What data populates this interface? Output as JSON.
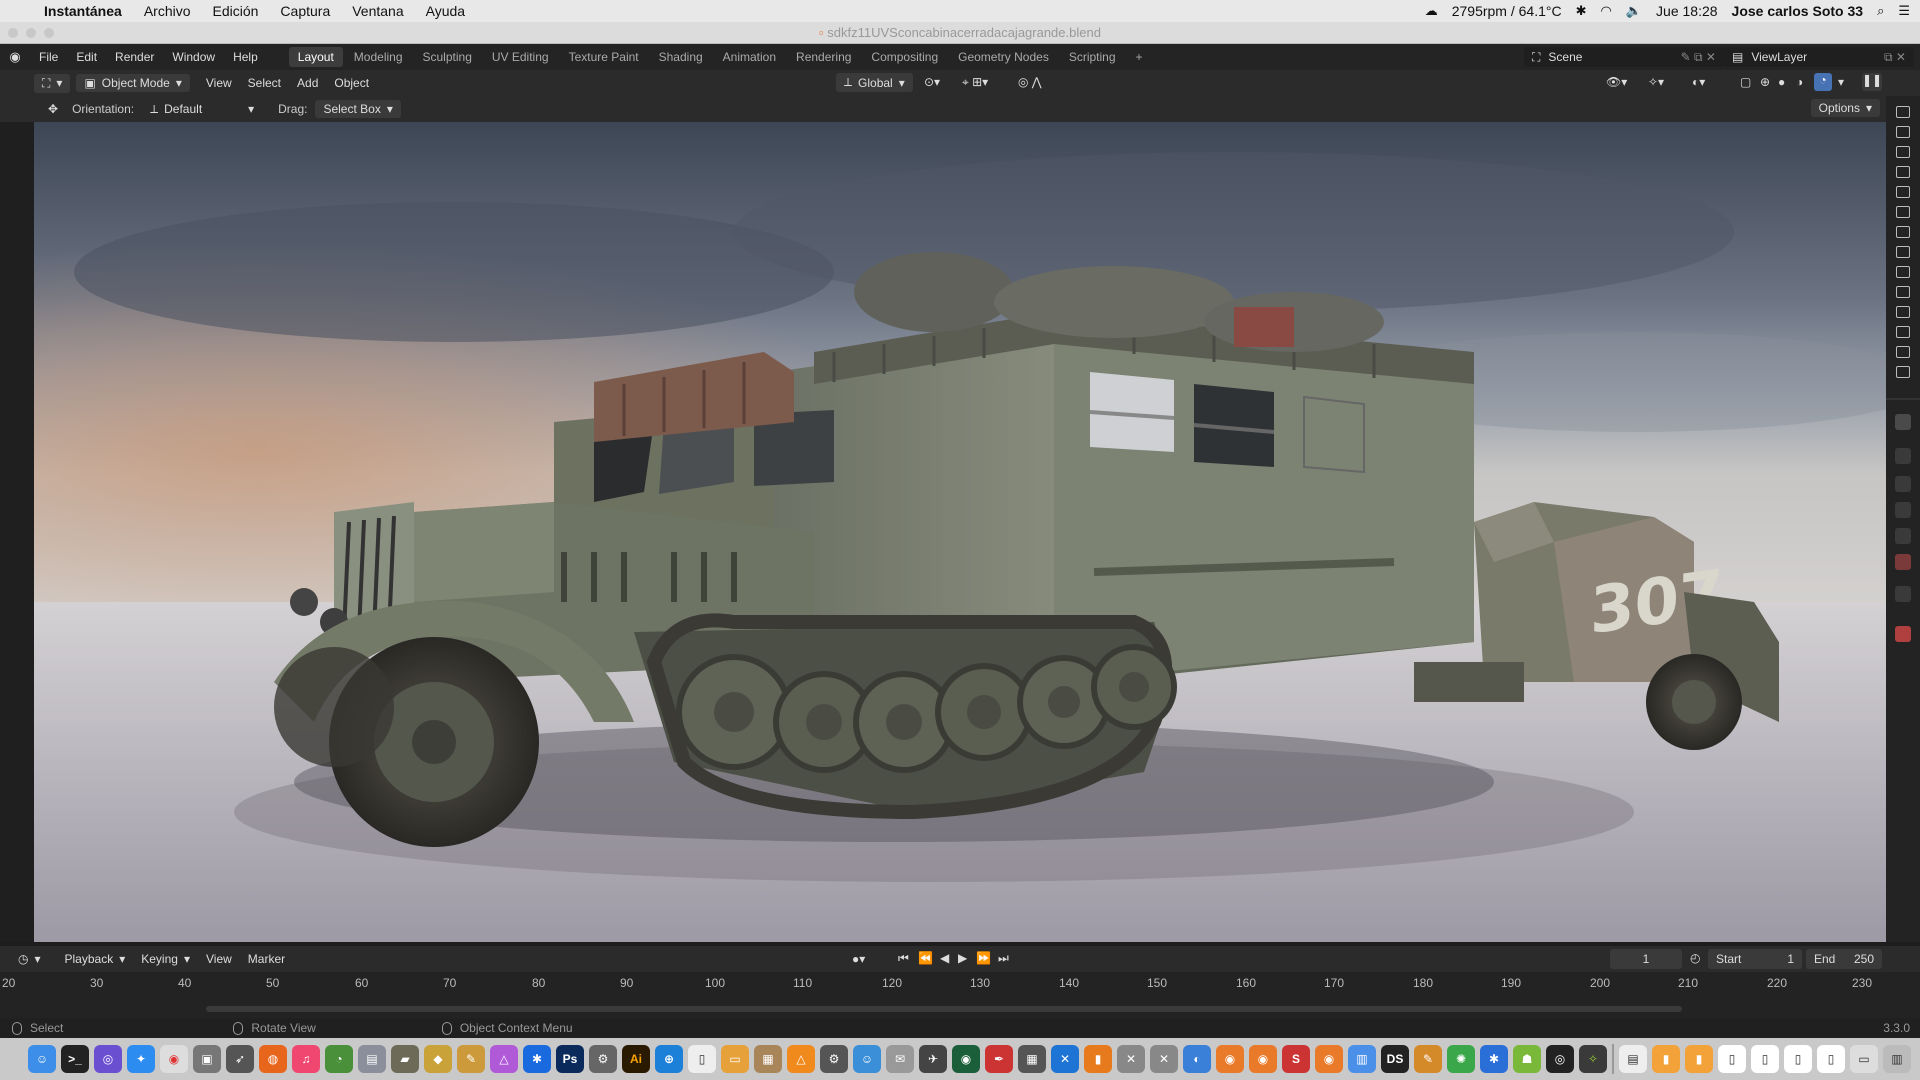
{
  "mac_menu": {
    "app": "Instantánea",
    "items": [
      "Archivo",
      "Edición",
      "Captura",
      "Ventana",
      "Ayuda"
    ],
    "status_rpm": "2795rpm / 64.1°C",
    "clock": "Jue 18:28",
    "user": "Jose carlos Soto 33"
  },
  "window": {
    "title": "sdkfz11UVSconcabinacerradacajagrande.blend"
  },
  "topbar": {
    "menus": [
      "File",
      "Edit",
      "Render",
      "Window",
      "Help"
    ],
    "workspaces": [
      "Layout",
      "Modeling",
      "Sculpting",
      "UV Editing",
      "Texture Paint",
      "Shading",
      "Animation",
      "Rendering",
      "Compositing",
      "Geometry Nodes",
      "Scripting"
    ],
    "active_workspace": "Layout",
    "add_tab": "+",
    "scene": "Scene",
    "view_layer": "ViewLayer"
  },
  "viewport_header": {
    "mode": "Object Mode",
    "menus": [
      "View",
      "Select",
      "Add",
      "Object"
    ],
    "transform_orientation": "Global",
    "options_label": "Options"
  },
  "tool_settings": {
    "orientation_label": "Orientation:",
    "orientation_value": "Default",
    "drag_label": "Drag:",
    "drag_value": "Select Box"
  },
  "scene_render": {
    "vehicle_marking": "307"
  },
  "timeline": {
    "menus": [
      "Playback",
      "Keying",
      "View",
      "Marker"
    ],
    "current_frame": "1",
    "start_label": "Start",
    "start_value": "1",
    "end_label": "End",
    "end_value": "250",
    "ruler": [
      "20",
      "30",
      "40",
      "50",
      "60",
      "70",
      "80",
      "90",
      "100",
      "110",
      "120",
      "130",
      "140",
      "150",
      "160",
      "170",
      "180",
      "190",
      "200",
      "210",
      "220",
      "230"
    ]
  },
  "statusbar": {
    "select": "Select",
    "rotate": "Rotate View",
    "context": "Object Context Menu",
    "version": "3.3.0"
  },
  "colors": {
    "ws_active_bg": "#3d3d3d",
    "accent_blue": "#4772b3",
    "panel_bg": "#2b2b2b"
  }
}
